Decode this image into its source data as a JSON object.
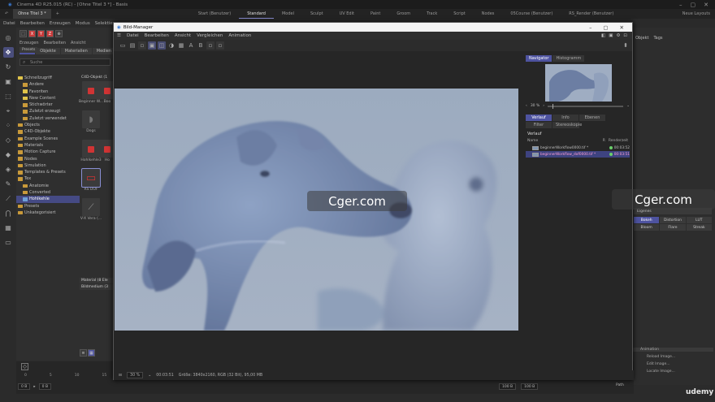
{
  "app": {
    "title": "Cinema 4D R25.015 (RC) - [Ohne Titel 3 *] - Basis",
    "doc_tab": "Ohne Titel 3 *",
    "layouts": [
      "Start (Benutzer)",
      "Standard",
      "Model",
      "Sculpt",
      "UV Edit",
      "Paint",
      "Groom",
      "Track",
      "Script",
      "Nodes",
      "05Course (Benutzer)",
      "RS_Render (Benutzer)"
    ],
    "active_layout": "Standard",
    "new_layouts": "Neue Layouts"
  },
  "menubar": [
    "Datei",
    "Bearbeiten",
    "Erzeugen",
    "Modus",
    "Selektieren"
  ],
  "tools_row": [
    "X",
    "Y",
    "Z"
  ],
  "asset_browser": {
    "menu": [
      "Erzeugen",
      "Bearbeiten",
      "Ansicht"
    ],
    "presets_tab": "Presets",
    "tabs": [
      "Alle",
      "Objekte",
      "Materialien",
      "Medien"
    ],
    "active_tab": "Alle",
    "search_placeholder": "Suche",
    "tree": [
      {
        "label": "Schnellzugriff",
        "indent": 2,
        "color": "yellow"
      },
      {
        "label": "Andere",
        "indent": 8,
        "color": "default"
      },
      {
        "label": "Favoriten",
        "indent": 8,
        "color": "yellow"
      },
      {
        "label": "New Content",
        "indent": 8,
        "color": "yellow"
      },
      {
        "label": "Stichwörter",
        "indent": 8,
        "color": "default"
      },
      {
        "label": "Zuletzt erzeugt",
        "indent": 8,
        "color": "default"
      },
      {
        "label": "Zuletzt verwendet",
        "indent": 8,
        "color": "default"
      },
      {
        "label": "Objects",
        "indent": 2,
        "color": "default"
      },
      {
        "label": "C4D-Objekte",
        "indent": 2,
        "color": "default"
      },
      {
        "label": "Example Scenes",
        "indent": 2,
        "color": "default"
      },
      {
        "label": "Materials",
        "indent": 2,
        "color": "default"
      },
      {
        "label": "Motion Capture",
        "indent": 2,
        "color": "default"
      },
      {
        "label": "Nodes",
        "indent": 2,
        "color": "default"
      },
      {
        "label": "Simulation",
        "indent": 2,
        "color": "default"
      },
      {
        "label": "Templates & Presets",
        "indent": 2,
        "color": "default"
      },
      {
        "label": "Tex",
        "indent": 2,
        "color": "default"
      },
      {
        "label": "Anatomie",
        "indent": 8,
        "color": "default"
      },
      {
        "label": "Converted",
        "indent": 8,
        "color": "default"
      },
      {
        "label": "Hohlkehle",
        "indent": 8,
        "color": "blue",
        "selected": true
      },
      {
        "label": "Presets",
        "indent": 2,
        "color": "default"
      },
      {
        "label": "Unkategorisiert",
        "indent": 2,
        "color": "default"
      }
    ],
    "asset_header": "C4D-Objekt (1",
    "assets": [
      {
        "label": "Beginner W...",
        "kind": "cube"
      },
      {
        "label": "Boo",
        "kind": "cube"
      },
      {
        "label": "Dogs",
        "kind": "dog"
      },
      {
        "label": "Hohlkehle3",
        "kind": "cube"
      },
      {
        "label": "Ho",
        "kind": "cube"
      },
      {
        "label": "RS DOF",
        "kind": "camera",
        "selected": true
      },
      {
        "label": "V-X Vera (...",
        "kind": "item"
      }
    ],
    "sections": [
      "Material (8 Ele",
      "Bildmedium (3"
    ]
  },
  "bild_manager": {
    "title": "Bild-Manager",
    "menu": [
      "Datei",
      "Bearbeiten",
      "Ansicht",
      "Vergleichen",
      "Animation"
    ],
    "navigator_tabs": [
      "Navigator",
      "Histogramm"
    ],
    "active_nav_tab": "Navigator",
    "zoom": "30 %",
    "info_tabs": [
      "Verlauf",
      "Info",
      "Ebenen"
    ],
    "info_tabs2": [
      "Filter",
      "Stereoskopie"
    ],
    "active_info_tab": "Verlauf",
    "verlauf_heading": "Verlauf",
    "columns": {
      "name": "Name",
      "r": "R",
      "time": "Renderzeit"
    },
    "history": [
      {
        "name": "beginnerWorkflow0000.tif *",
        "time": "00:03:52",
        "selected": false
      },
      {
        "name": "beginnerWorkflow_dof0000.tif *",
        "time": "00:03:51",
        "selected": true
      }
    ],
    "status": {
      "zoom": "30 %",
      "time": "00:03:51",
      "size": "Größe: 3840x2160, RGB (32 Bit), 95,00 MB"
    }
  },
  "watermark": "Cger.com",
  "right_panel": {
    "tabs": [
      "Objekt",
      "Tags"
    ],
    "buttons": [
      "Bokeh",
      "Distortion",
      "LUT",
      "Bloom",
      "Flare",
      "Streak"
    ],
    "dropdown": "Eigenes",
    "animation": "Animation",
    "reload": "Reload Image...",
    "edit": "Edit Image...",
    "locate": "Locate Image..."
  },
  "timeline": {
    "ticks": [
      "0",
      "5",
      "10",
      "15"
    ],
    "start": "0 B",
    "current": "0 B",
    "end1": "100 B",
    "end2": "100 B",
    "path": "Path"
  },
  "branding": "udemy",
  "colors": {
    "accent": "#4e53a0",
    "selection": "#454a84"
  }
}
